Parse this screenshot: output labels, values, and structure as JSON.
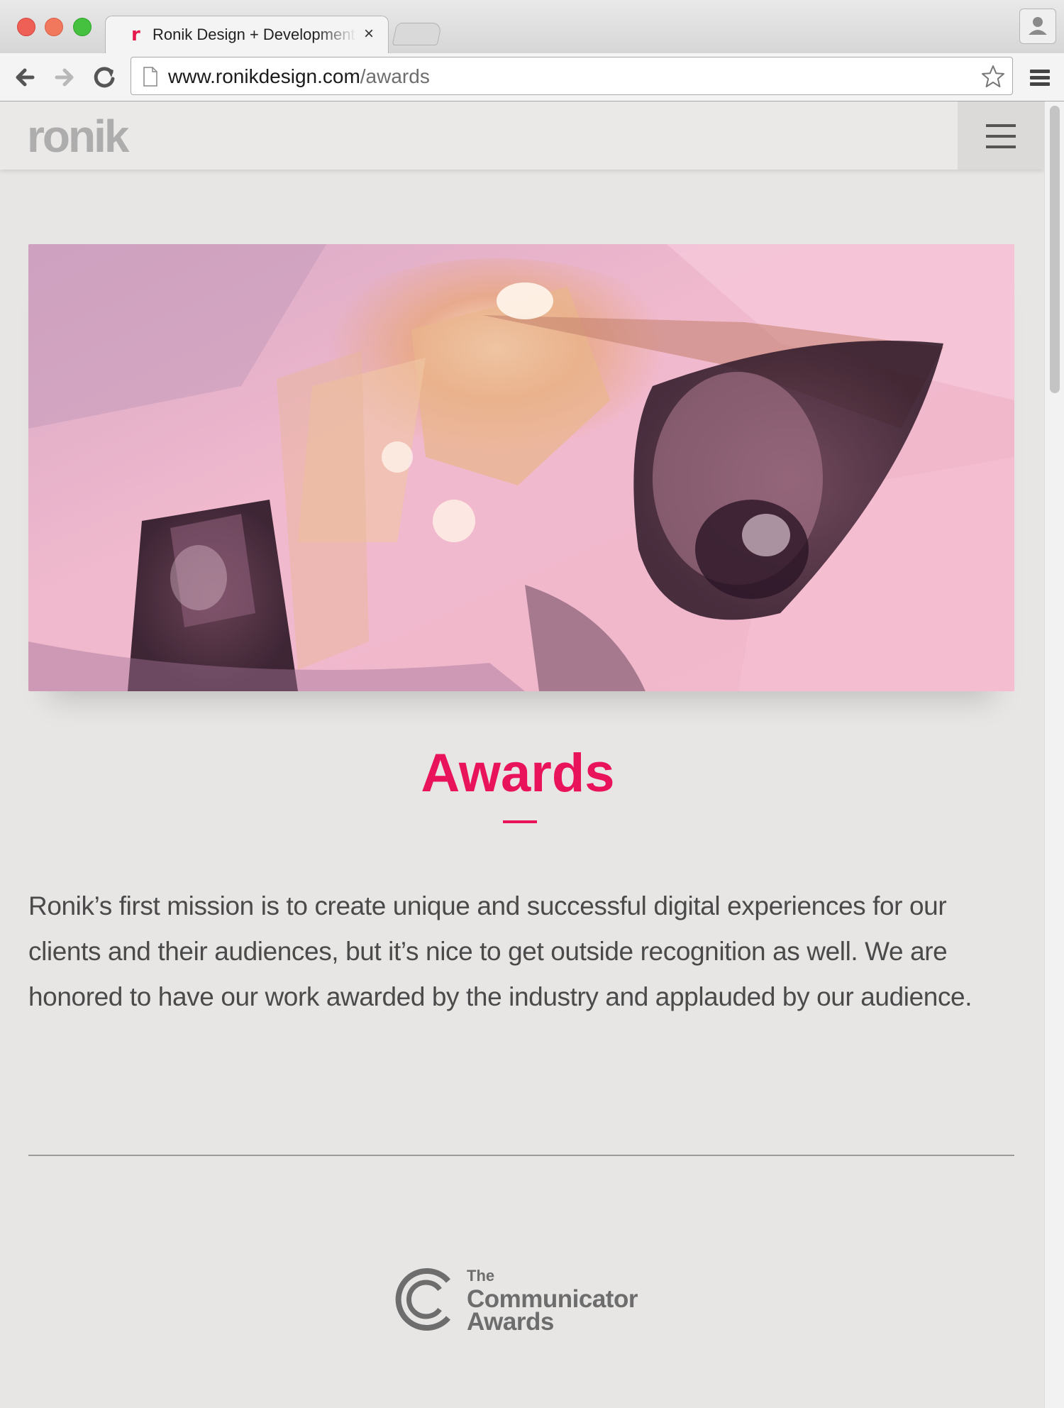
{
  "browser": {
    "tab_title": "Ronik Design + Development",
    "tab_close": "×",
    "url_host": "www.ronikdesign.com",
    "url_path": "/awards"
  },
  "header": {
    "logo_text": "ronik"
  },
  "page": {
    "title": "Awards",
    "intro": "Ronik’s first mission is to create unique and successful digital experiences for our clients and their audiences, but it’s nice to get outside recognition as well. We are honored to have our work awarded by the industry and applauded by our audience.",
    "award_logo": {
      "line1": "The",
      "line2": "Communicator",
      "line3": "Awards"
    }
  },
  "colors": {
    "accent": "#e8135a",
    "logo_gray": "#adadad",
    "background": "#e8e6e5"
  },
  "icons": {
    "back": "arrow-left-icon",
    "forward": "arrow-right-icon",
    "reload": "reload-icon",
    "star": "star-icon",
    "menu": "menu-icon",
    "profile": "profile-icon",
    "hamburger": "hamburger-icon"
  }
}
